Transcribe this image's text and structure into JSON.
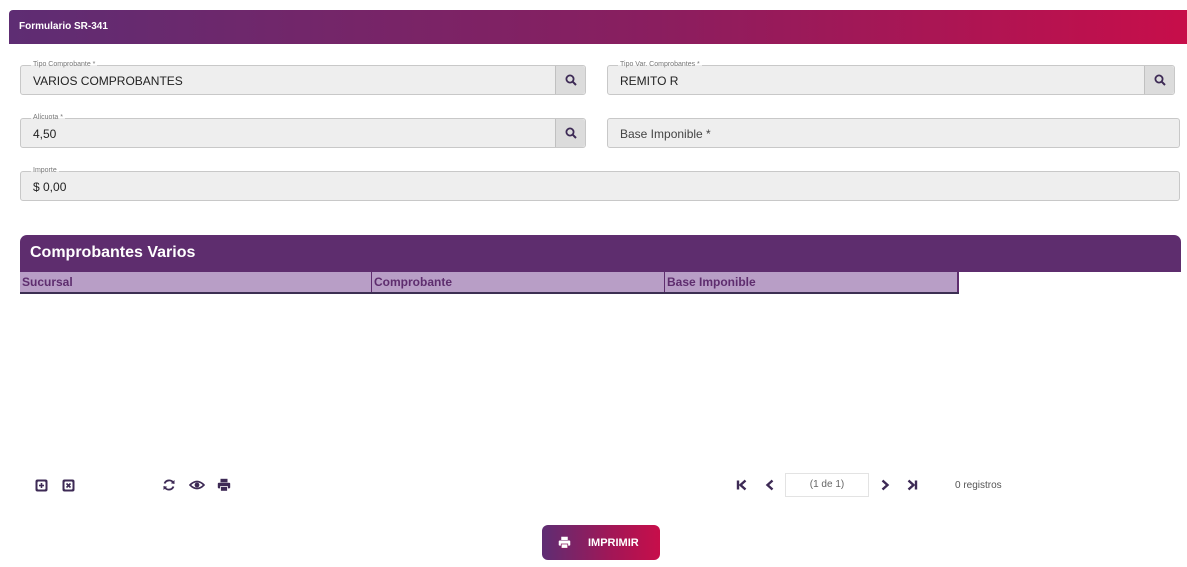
{
  "header": {
    "title": "Formulario SR-341"
  },
  "form": {
    "tipo_comprobante": {
      "label": "Tipo Comprobante *",
      "value": "VARIOS COMPROBANTES"
    },
    "tipo_var_comprobantes": {
      "label": "Tipo Var. Comprobantes *",
      "value": "REMITO R"
    },
    "alicuota": {
      "label": "Alícuota *",
      "value": "4,50"
    },
    "base_imponible": {
      "placeholder": "Base Imponible *"
    },
    "importe": {
      "label": "Importe",
      "value": "$ 0,00"
    }
  },
  "grid": {
    "title": "Comprobantes Varios",
    "columns": [
      "Sucursal",
      "Comprobante",
      "Base Imponible"
    ],
    "rows": []
  },
  "toolbar": {
    "icons": [
      "plus-square-icon",
      "close-square-icon",
      "refresh-icon",
      "eye-icon",
      "print-icon"
    ]
  },
  "pager": {
    "info": "(1 de 1)",
    "records": "0 registros"
  },
  "actions": {
    "print_label": "IMPRIMIR"
  },
  "colors": {
    "brand_purple": "#5e2d6e",
    "brand_red": "#c70e4a",
    "header_row": "#b89ec6"
  }
}
